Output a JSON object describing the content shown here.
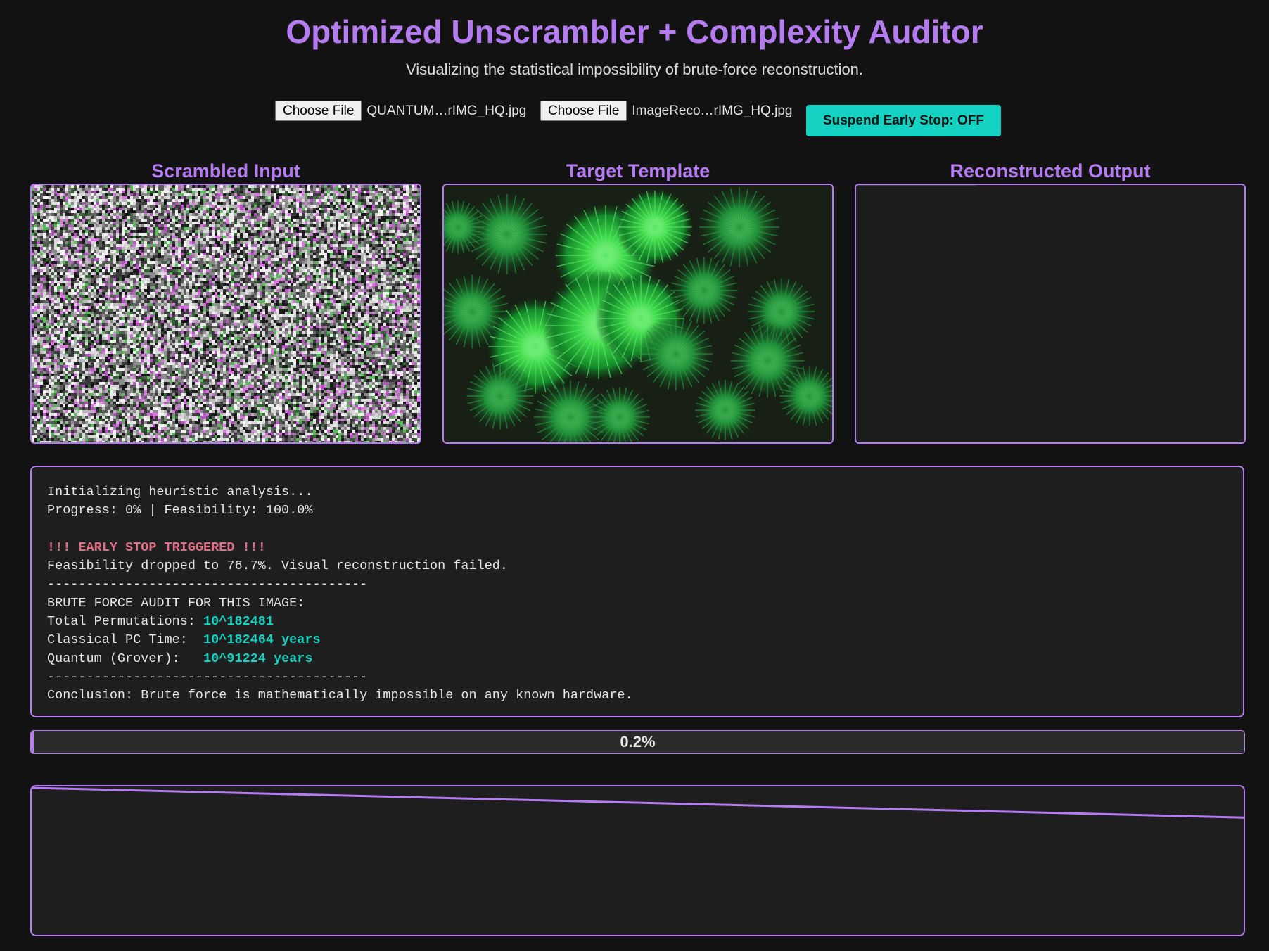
{
  "header": {
    "title": "Optimized Unscrambler + Complexity Auditor",
    "subtitle": "Visualizing the statistical impossibility of brute-force reconstruction."
  },
  "controls": {
    "file1": {
      "button_label": "Choose File",
      "file_name": "QUANTUM…rIMG_HQ.jpg"
    },
    "file2": {
      "button_label": "Choose File",
      "file_name": "ImageReco…rIMG_HQ.jpg"
    },
    "toggle_label": "Suspend Early Stop: OFF"
  },
  "panels": {
    "scrambled_title": "Scrambled Input",
    "target_title": "Target Template",
    "output_title": "Reconstructed Output"
  },
  "console": {
    "line1": "Initializing heuristic analysis...",
    "line2": "Progress: 0% | Feasibility: 100.0%",
    "warning": "!!! EARLY STOP TRIGGERED !!!",
    "line4": "Feasibility dropped to 76.7%. Visual reconstruction failed.",
    "divider": "-----------------------------------------",
    "audit_header": "BRUTE FORCE AUDIT FOR THIS IMAGE:",
    "perm_label": "Total Permutations: ",
    "perm_value": "10^182481",
    "classical_label": "Classical PC Time:  ",
    "classical_value": "10^182464 years",
    "quantum_label": "Quantum (Grover):   ",
    "quantum_value": "10^91224 years",
    "conclusion": "Conclusion: Brute force is mathematically impossible on any known hardware."
  },
  "progress": {
    "label": "0.2%",
    "value_fraction": 0.002
  },
  "feasibility_graph": {
    "start": 100.0,
    "end": 76.7
  },
  "colors": {
    "accent": "#b57cf2",
    "teal": "#14d3c2",
    "warning": "#e06c86",
    "background": "#121212"
  }
}
